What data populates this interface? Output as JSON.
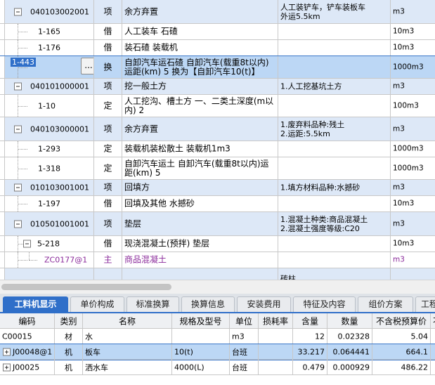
{
  "top_rows": [
    {
      "code": "040103002001",
      "type": "项",
      "name": "余方弃置",
      "feature": "人工装铲车，铲车装板车\n外运5.5km",
      "unit": "m3",
      "level": 0,
      "toggle": true,
      "alt": true
    },
    {
      "code": "1-165",
      "type": "借",
      "name": "人工装车 石碴",
      "feature": "",
      "unit": "10m3",
      "level": 1
    },
    {
      "code": "1-176",
      "type": "借",
      "name": "装石碴 装载机",
      "feature": "",
      "unit": "10m3",
      "level": 1
    },
    {
      "code": "1-443",
      "type": "换",
      "name": "自卸汽车运石碴 自卸汽车(载重8t以内)\n运距(km) 5  换为【自卸汽车10(t)】",
      "feature": "",
      "unit": "1000m3",
      "level": 1,
      "selected": true,
      "button": "..."
    },
    {
      "code": "040101000001",
      "type": "项",
      "name": "挖一般土方",
      "feature": "1.人工挖基坑土方",
      "unit": "m3",
      "level": 0,
      "toggle": true,
      "alt": true
    },
    {
      "code": "1-10",
      "type": "定",
      "name": "人工挖沟、槽土方 一、二类土深度(m以\n内) 2",
      "feature": "",
      "unit": "100m3",
      "level": 1
    },
    {
      "code": "040103000001",
      "type": "项",
      "name": "余方弃置",
      "feature": "1.废弃料品种:残土\n2.运距:5.5km",
      "unit": "m3",
      "level": 0,
      "toggle": true,
      "alt": true
    },
    {
      "code": "1-293",
      "type": "定",
      "name": "装载机装松散土 装载机1m3",
      "feature": "",
      "unit": "1000m3",
      "level": 1
    },
    {
      "code": "1-318",
      "type": "定",
      "name": "自卸汽车运土 自卸汽车(载重8t以内)运\n距(km) 5",
      "feature": "",
      "unit": "1000m3",
      "level": 1
    },
    {
      "code": "010103001001",
      "type": "项",
      "name": "回填方",
      "feature": "1.填方材料品种:水撼砂",
      "unit": "m3",
      "level": 0,
      "toggle": true,
      "alt": true
    },
    {
      "code": "1-197",
      "type": "借",
      "name": "回填及其他 水撼砂",
      "feature": "",
      "unit": "10m3",
      "level": 1
    },
    {
      "code": "010501001001",
      "type": "项",
      "name": "垫层",
      "feature": "1.混凝土种类:商品混凝土\n2.混凝土强度等级:C20",
      "unit": "m3",
      "level": 0,
      "toggle": true,
      "alt": true
    },
    {
      "code": "5-218",
      "type": "借",
      "name": "现浇混凝土(预拌) 垫层",
      "feature": "",
      "unit": "10m3",
      "level": 1,
      "toggle": true
    },
    {
      "code": "ZC0177@1",
      "type": "主",
      "name": "商品混凝土",
      "feature": "",
      "unit": "m3",
      "level": 2,
      "purple": true
    },
    {
      "code": "",
      "type": "",
      "name": "",
      "feature": "砖柱",
      "unit": "",
      "level": 0,
      "alt": true
    }
  ],
  "tabs": [
    "工料机显示",
    "单价构成",
    "标准换算",
    "换算信息",
    "安装费用",
    "特征及内容",
    "组价方案",
    "工程"
  ],
  "bottom_table": {
    "headers": [
      "编码",
      "类别",
      "名称",
      "规格及型号",
      "单位",
      "损耗率",
      "含量",
      "数量",
      "不含税预算价",
      "不"
    ],
    "rows": [
      {
        "code": "C00015",
        "category": "材",
        "name": "水",
        "spec": "",
        "unit": "m3",
        "loss": "",
        "content": "12",
        "quantity": "0.02328",
        "price": "5.04"
      },
      {
        "code": "J00048@1",
        "category": "机",
        "name": "板车",
        "spec": "10(t)",
        "unit": "台班",
        "loss": "",
        "content": "33.217",
        "quantity": "0.064441",
        "price": "664.1",
        "expandable": true,
        "selected": true
      },
      {
        "code": "J00025",
        "category": "机",
        "name": "洒水车",
        "spec": "4000(L)",
        "unit": "台班",
        "loss": "",
        "content": "0.479",
        "quantity": "0.000929",
        "price": "486.22",
        "expandable": true
      }
    ]
  }
}
